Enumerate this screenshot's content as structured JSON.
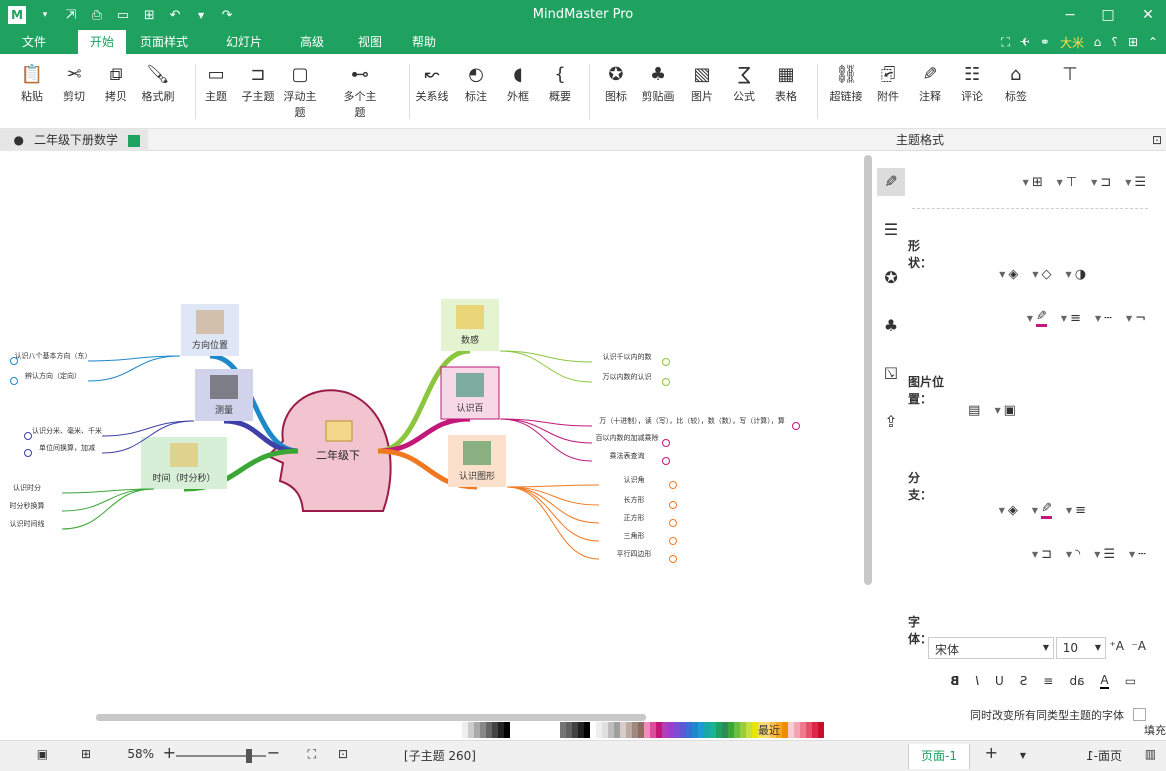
{
  "app": {
    "title": "MindMaster Pro",
    "logo": "mindmaster-logo"
  },
  "quick_access": [
    "undo-icon",
    "redo-icon",
    "new-icon",
    "open-icon",
    "save-icon",
    "print-icon",
    "export-icon",
    "more-icon"
  ],
  "menubar": {
    "tabs": [
      {
        "label": "文件",
        "active": false
      },
      {
        "label": "开始",
        "active": true
      },
      {
        "label": "页面样式",
        "active": false
      },
      {
        "label": "幻灯片",
        "active": false
      },
      {
        "label": "高级",
        "active": false
      },
      {
        "label": "视图",
        "active": false
      },
      {
        "label": "帮助",
        "active": false
      }
    ],
    "right_label": "大米"
  },
  "ribbon": {
    "buttons": [
      {
        "label": "粘贴",
        "icon": "paste-icon"
      },
      {
        "label": "剪切",
        "icon": "cut-icon"
      },
      {
        "label": "拷贝",
        "icon": "copy-icon"
      },
      {
        "label": "格式刷",
        "icon": "format-painter-icon"
      },
      {
        "label": "主题",
        "icon": "topic-icon"
      },
      {
        "label": "子主题",
        "icon": "subtopic-icon"
      },
      {
        "label": "浮动主题",
        "icon": "floating-topic-icon"
      },
      {
        "label": "多个主题",
        "icon": "multiple-topics-icon"
      },
      {
        "label": "关系线",
        "icon": "relationship-icon"
      },
      {
        "label": "标注",
        "icon": "callout-icon"
      },
      {
        "label": "外框",
        "icon": "boundary-icon"
      },
      {
        "label": "概要",
        "icon": "summary-icon"
      },
      {
        "label": "图标",
        "icon": "mark-icon"
      },
      {
        "label": "剪贴画",
        "icon": "clipart-icon"
      },
      {
        "label": "图片",
        "icon": "image-icon"
      },
      {
        "label": "公式",
        "icon": "formula-icon"
      },
      {
        "label": "表格",
        "icon": "table-icon"
      },
      {
        "label": "超链接",
        "icon": "hyperlink-icon"
      },
      {
        "label": "附件",
        "icon": "attachment-icon"
      },
      {
        "label": "注释",
        "icon": "note-icon"
      },
      {
        "label": "评论",
        "icon": "comment-icon"
      },
      {
        "label": "标签",
        "icon": "tag-icon"
      },
      {
        "label": "",
        "icon": "layout-icon"
      }
    ]
  },
  "document_tab": "二年级下册数学",
  "panel": {
    "title": "主题格式",
    "sections": {
      "shape": "形状：",
      "image_position": "图片位置：",
      "branch": "分支：",
      "font": "字体："
    },
    "font_name": "宋体",
    "font_size": "10",
    "checkbox_label": "同时改变所有同类型主题的字体"
  },
  "mindmap": {
    "central": "二年级下",
    "topics": [
      {
        "label": "方向位置",
        "color": "#1e88c8"
      },
      {
        "label": "测量",
        "color": "#3f3fa8"
      },
      {
        "label": "时间（时分秒）",
        "color": "#3aa635"
      },
      {
        "label": "数感",
        "color": "#8cc63f"
      },
      {
        "label": "认识百",
        "color": "#c2187a"
      },
      {
        "label": "认识图形",
        "color": "#f07820"
      }
    ],
    "subtopics": {
      "fangxiang": [
        "认识八个基本方向（东）",
        "辨认方向（定向）"
      ],
      "celiang": [
        "认识分米、毫米、千米",
        "单位间换算，加减"
      ],
      "shijian": [
        "认识时分",
        "时分秒换算",
        "认识时间线"
      ],
      "shugan": [
        "认识千以内的数",
        "万以内数的认识"
      ],
      "baiwei": [
        "万（十进制），读（写），比（较），数（数），写（计算），算",
        "百以内数的加减乘除",
        "乘法表查询"
      ],
      "tuxing": [
        "认识角",
        "长方形",
        "正方形",
        "三角形",
        "平行四边形"
      ]
    }
  },
  "palette": {
    "recent_label": "最近",
    "fill_label": "填充",
    "colors": [
      "#c8102e",
      "#e0274a",
      "#e84f6b",
      "#f07a8d",
      "#f4a3b0",
      "#f9ccd4",
      "#f08c00",
      "#f5a623",
      "#f8c04a",
      "#fbd97b",
      "#f6e05e",
      "#e6e600",
      "#c9df3f",
      "#9ccc3a",
      "#6bbf3f",
      "#3aa635",
      "#2e8b57",
      "#1fa160",
      "#1ab394",
      "#19a7a7",
      "#1e9bd7",
      "#1e88c8",
      "#3b6fd6",
      "#5a5ad6",
      "#7b4ed4",
      "#9c3fd1",
      "#b33fb8",
      "#c2187a",
      "#e04c9c",
      "#f08cc0",
      "#8d6e63",
      "#a1887f",
      "#bcaaa4",
      "#d7ccc8",
      "#9e9e9e",
      "#bdbdbd",
      "#e0e0e0",
      "#eeeeee",
      "#ffffff",
      "#000000",
      "#212121",
      "#424242",
      "#616161",
      "#757575"
    ]
  },
  "status": {
    "page_label": "页面-1",
    "active_page": "页面-1",
    "selection": "[子主题 260]",
    "zoom": "58%"
  }
}
